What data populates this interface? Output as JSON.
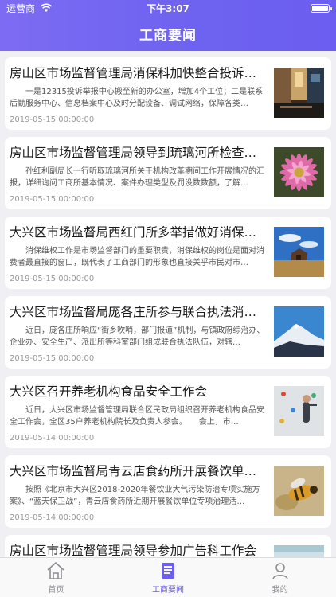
{
  "status": {
    "carrier": "运营商",
    "time": "下午3:07"
  },
  "nav": {
    "title": "工商要闻"
  },
  "articles": [
    {
      "title": "房山区市场监督管理局消保科加快整合投诉…",
      "summary": "一是12315投诉举报中心搬至新的办公室，增加4个工位；二是联系后勤服务中心、信息档案中心及时分配设备、调试网络，保障各类…",
      "date": "2019-05-15 00:00:00",
      "image": "street-photo"
    },
    {
      "title": "房山区市场监督管理局领导到琉璃河所检查…",
      "summary": "孙红利副局长一行听取琉璃河所关于机构改革期间工作开展情况的汇报，详细询问工商所基本情况、案件办理类型及罚没数数额，了解…",
      "date": "2019-05-15 00:00:00",
      "image": "flower-photo"
    },
    {
      "title": "大兴区市场监督局西红门所多举措做好消保…",
      "summary": "消保维权工作是市场监督部门的重要职责，消保维权的岗位是面对消费者最直接的窗口，既代表了工商部门的形象也直接关乎市民对市…",
      "date": "2019-05-15 00:00:00",
      "image": "barn-photo"
    },
    {
      "title": "大兴区市场监督局庞各庄所参与联合执法消…",
      "summary": "近日，庞各庄所响应“街乡吹哨，部门报道”机制，与镇政府综治办、企业办、安全生产、派出所等科室部门组成联合执法队伍，对辖…",
      "date": "2019-05-15 00:00:00",
      "image": "mountain-photo"
    },
    {
      "title": "大兴区召开养老机构食品安全工作会",
      "summary": "近日，大兴区市场监督管理局联合区民政局组织召开养老机构食品安全工作会，全区35户养老机构院长及负责人参会。　　会上，市…",
      "date": "2019-05-14 00:00:00",
      "image": "climbing-photo"
    },
    {
      "title": "大兴区市场监督局青云店食药所开展餐饮单…",
      "summary": "按照《北京市大兴区2018-2020年餐饮业大气污染防治专项实施方案》、“蓝天保卫战”，青云店食药所近期开展餐饮单位专项治理活…",
      "date": "2019-05-14 00:00:00",
      "image": "bee-photo"
    },
    {
      "title": "房山区市场监督管理局领导参加广告科工作会",
      "summary": "",
      "date": "",
      "image": "partial-photo"
    }
  ],
  "tabs": [
    {
      "label": "首页",
      "icon": "home-icon",
      "active": false
    },
    {
      "label": "工商要闻",
      "icon": "news-icon",
      "active": true
    },
    {
      "label": "我的",
      "icon": "profile-icon",
      "active": false
    }
  ],
  "colors": {
    "accent": "#6b5ef0",
    "header_start": "#7d6cf3",
    "header_end": "#6b5ef0"
  }
}
